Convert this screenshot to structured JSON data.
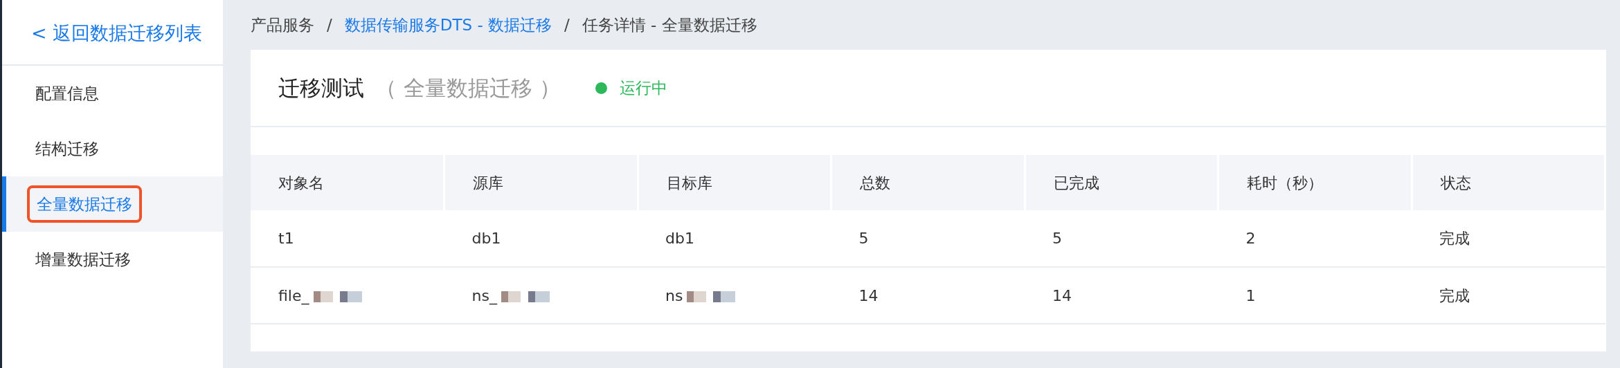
{
  "sidebar": {
    "back_link": "< 返回数据迁移列表",
    "items": [
      {
        "label": "配置信息",
        "selected": false,
        "annotated": false
      },
      {
        "label": "结构迁移",
        "selected": false,
        "annotated": false
      },
      {
        "label": "全量数据迁移",
        "selected": true,
        "annotated": true
      },
      {
        "label": "增量数据迁移",
        "selected": false,
        "annotated": false
      }
    ]
  },
  "breadcrumb_separator": "/",
  "breadcrumb": [
    {
      "label": "产品服务",
      "link": false
    },
    {
      "label": "数据传输服务DTS - 数据迁移",
      "link": true
    },
    {
      "label": "任务详情 - 全量数据迁移",
      "link": false
    }
  ],
  "task": {
    "title": "迁移测试",
    "subtitle": "（ 全量数据迁移 ）",
    "status": "运行中"
  },
  "table": {
    "columns": [
      "对象名",
      "源库",
      "目标库",
      "总数",
      "已完成",
      "耗时（秒）",
      "状态"
    ],
    "rows": [
      {
        "cells": [
          {
            "text": "t1",
            "redacted": false
          },
          {
            "text": "db1",
            "redacted": false
          },
          {
            "text": "db1",
            "redacted": false
          },
          {
            "text": "5",
            "redacted": false
          },
          {
            "text": "5",
            "redacted": false
          },
          {
            "text": "2",
            "redacted": false
          },
          {
            "text": "完成",
            "redacted": false
          }
        ]
      },
      {
        "cells": [
          {
            "text": "file_",
            "redacted": true
          },
          {
            "text": "ns_",
            "redacted": true
          },
          {
            "text": "ns",
            "redacted": true
          },
          {
            "text": "14",
            "redacted": false
          },
          {
            "text": "14",
            "redacted": false
          },
          {
            "text": "1",
            "redacted": false
          },
          {
            "text": "完成",
            "redacted": false
          }
        ]
      }
    ]
  }
}
